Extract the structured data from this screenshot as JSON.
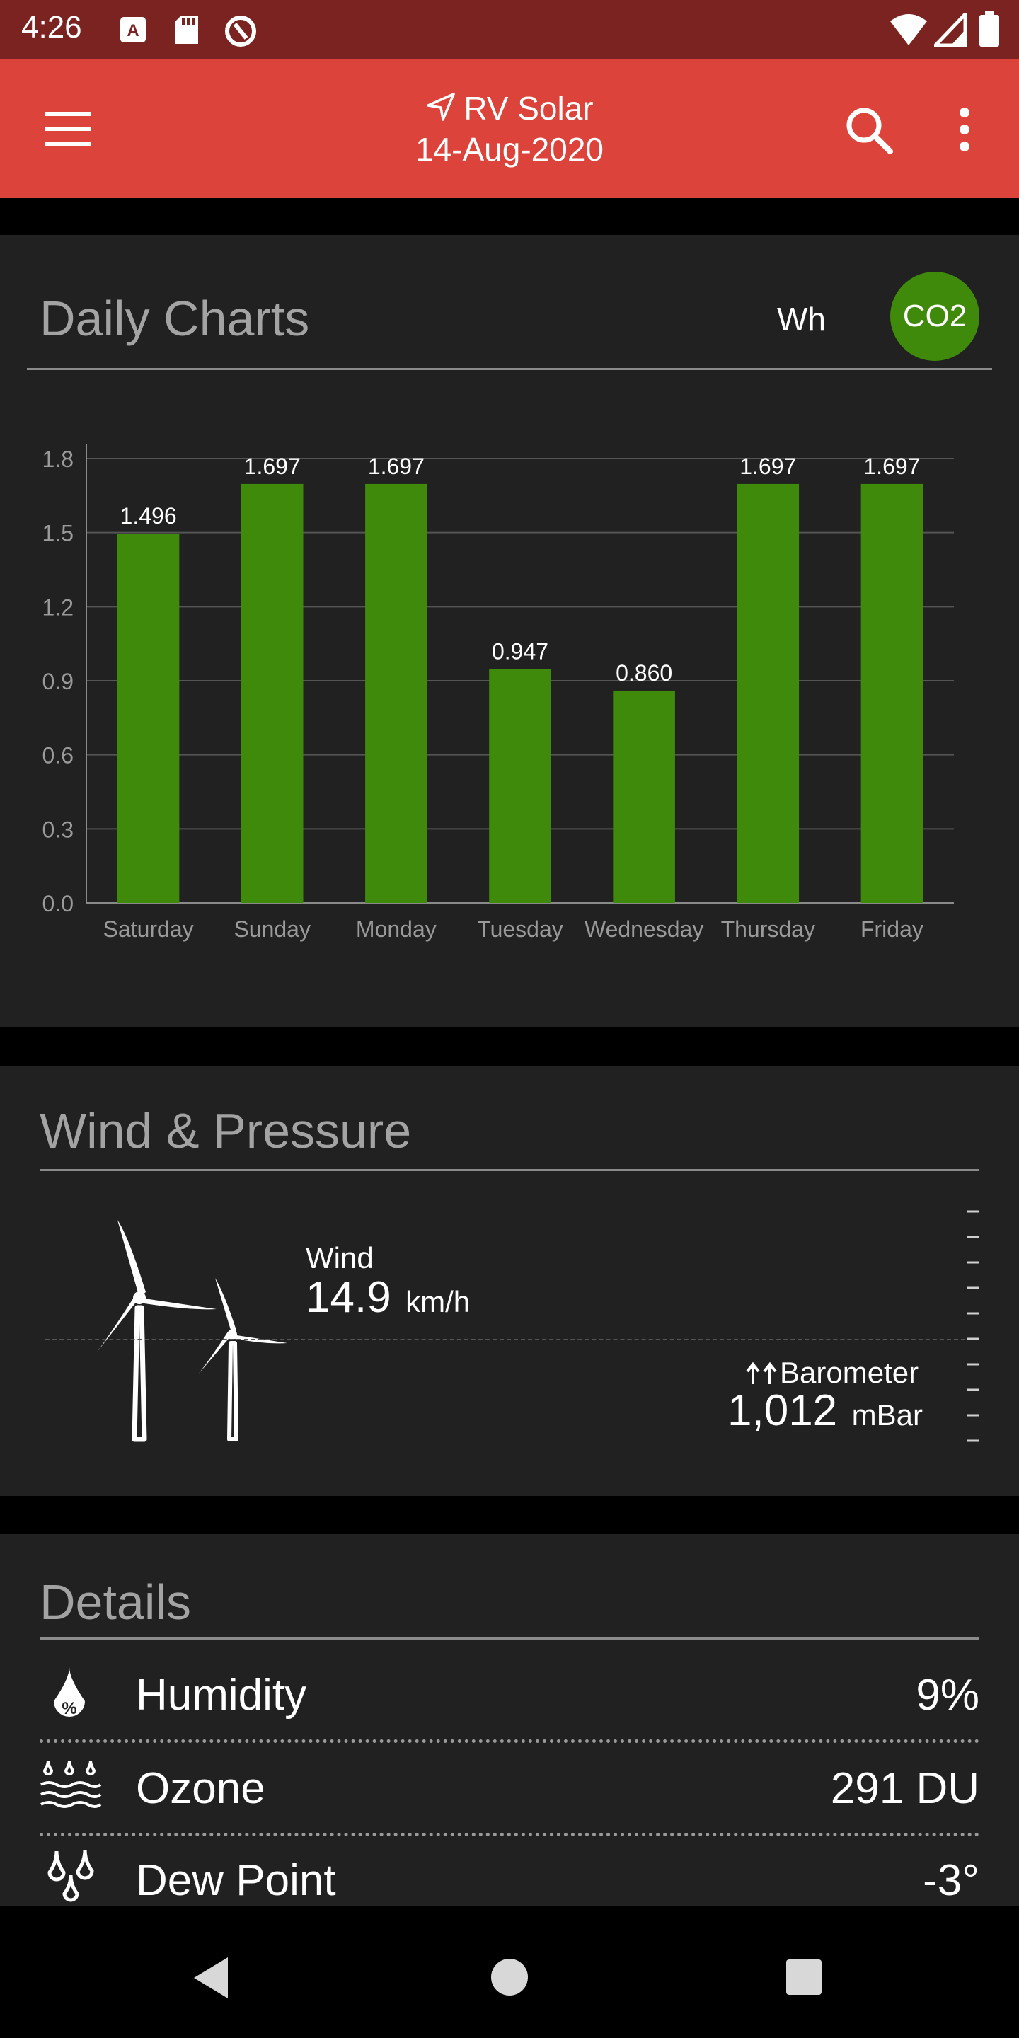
{
  "status_bar": {
    "time": "4:26"
  },
  "app_bar": {
    "title": "RV Solar",
    "date": "14-Aug-2020"
  },
  "daily_charts": {
    "title": "Daily Charts",
    "toggle_wh": "Wh",
    "toggle_co2": "CO2"
  },
  "chart_data": {
    "type": "bar",
    "categories": [
      "Saturday",
      "Sunday",
      "Monday",
      "Tuesday",
      "Wednesday",
      "Thursday",
      "Friday"
    ],
    "values": [
      1.496,
      1.697,
      1.697,
      0.947,
      0.86,
      1.697,
      1.697
    ],
    "value_labels": [
      "1.496",
      "1.697",
      "1.697",
      "0.947",
      "0.860",
      "1.697",
      "1.697"
    ],
    "y_ticks": [
      "0.0",
      "0.3",
      "0.6",
      "0.9",
      "1.2",
      "1.5",
      "1.8"
    ],
    "ylim": [
      0,
      1.8
    ],
    "bar_color": "#3f8a0b",
    "grid": true
  },
  "wind_pressure": {
    "title": "Wind & Pressure",
    "wind_label": "Wind",
    "wind_value": "14.9",
    "wind_unit": "km/h",
    "barometer_label": "Barometer",
    "barometer_value": "1,012",
    "barometer_unit": "mBar"
  },
  "details": {
    "title": "Details",
    "rows": [
      {
        "label": "Humidity",
        "value": "9%",
        "icon": "humidity-drop-icon"
      },
      {
        "label": "Ozone",
        "value": "291 DU",
        "icon": "ozone-waves-icon"
      },
      {
        "label": "Dew Point",
        "value": "-3°",
        "icon": "dew-point-icon"
      }
    ]
  },
  "colors": {
    "status_bar": "#7b2320",
    "app_bar": "#dc433a",
    "card_bg": "#202120",
    "accent_green": "#3f8a0b"
  }
}
